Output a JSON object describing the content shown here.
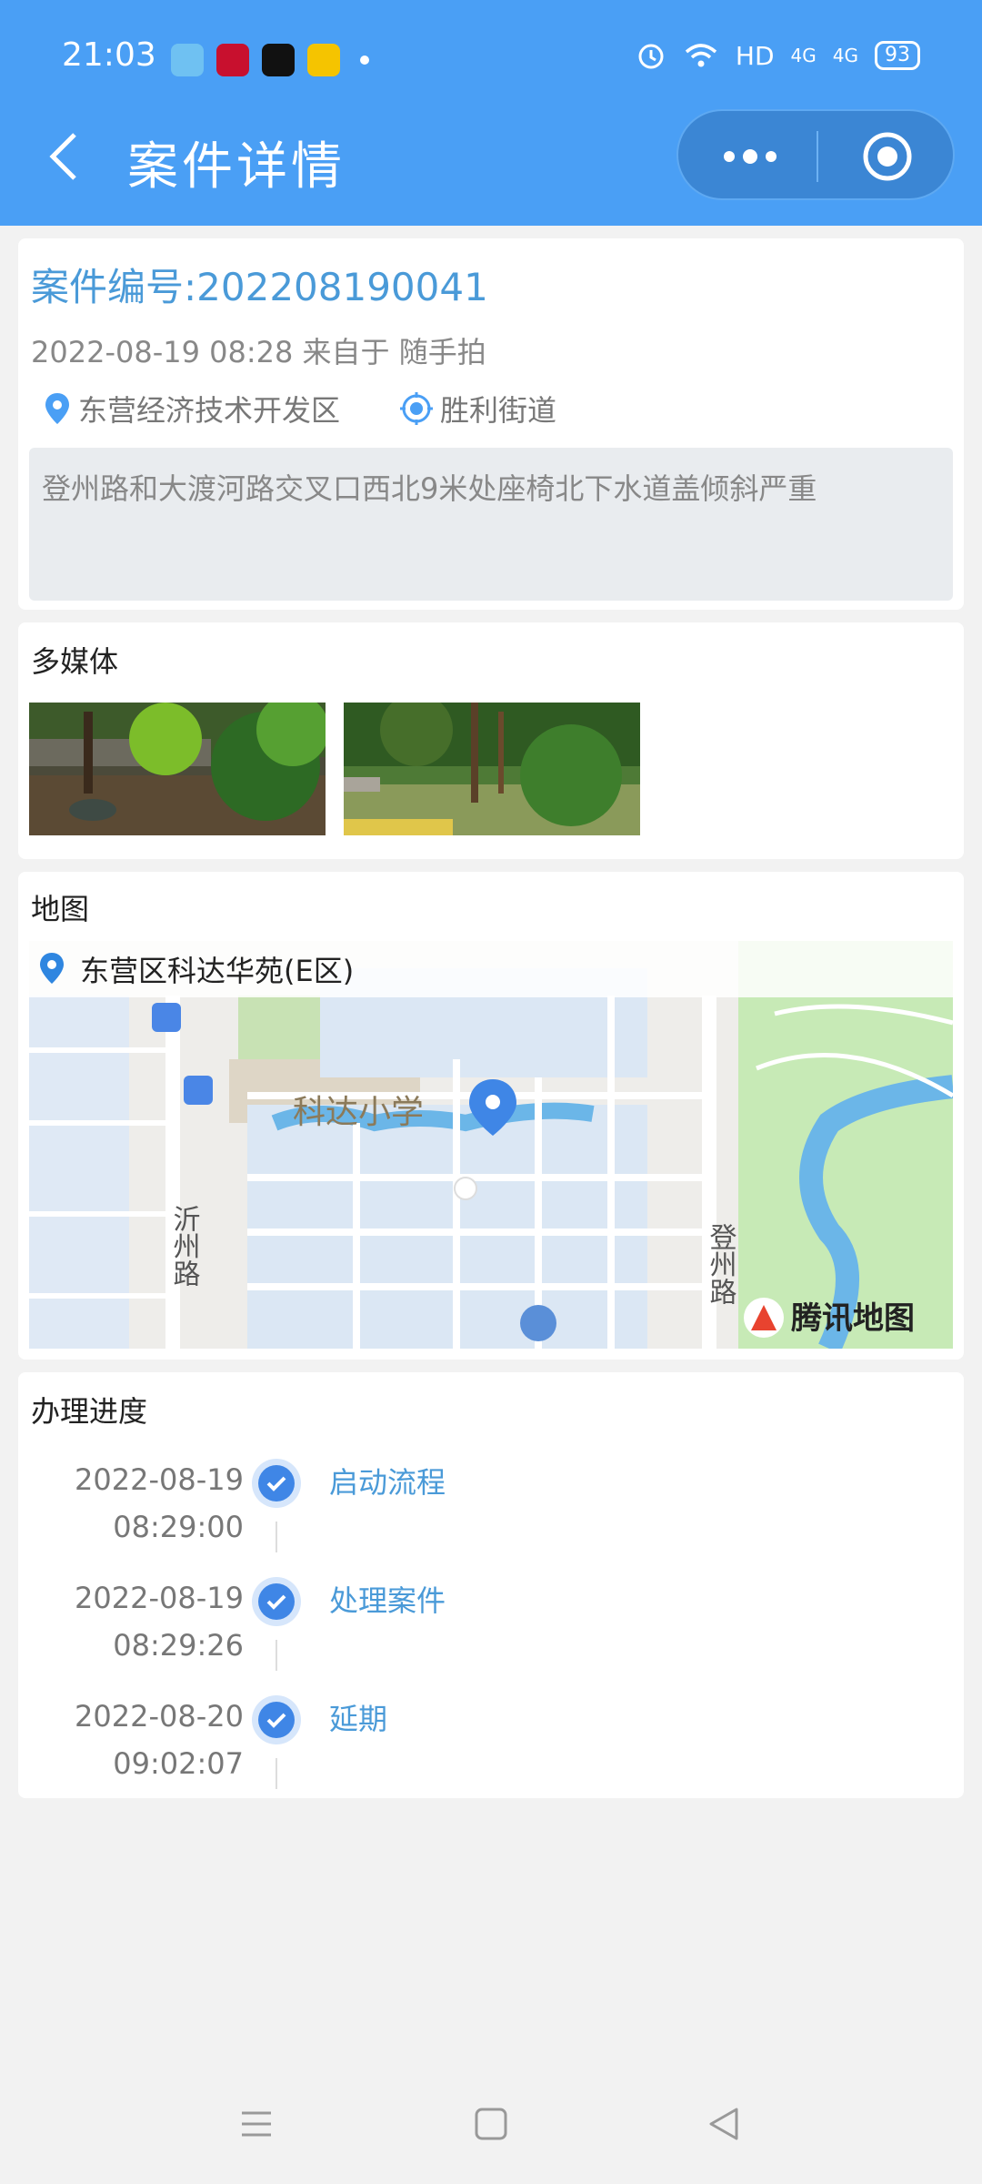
{
  "status_bar": {
    "time": "21:03",
    "network": "HD",
    "signal1": "4G",
    "signal2": "4G",
    "battery": "93"
  },
  "header": {
    "title": "案件详情"
  },
  "case": {
    "number": "案件编号:202208190041",
    "meta": "2022-08-19 08:28 来自于 随手拍",
    "district": "东营经济技术开发区",
    "street": "胜利街道",
    "description": "登州路和大渡河路交叉口西北9米处座椅北下水道盖倾斜严重"
  },
  "media": {
    "title": "多媒体"
  },
  "map": {
    "title": "地图",
    "address": "东营区科达华苑(E区)",
    "labels": {
      "school": "科达小学",
      "road_left": "沂州路",
      "road_right": "登州路",
      "brand": "腾讯地图"
    }
  },
  "progress": {
    "title": "办理进度",
    "steps": [
      {
        "date": "2022-08-19",
        "time": "08:29:00",
        "label": "启动流程"
      },
      {
        "date": "2022-08-19",
        "time": "08:29:26",
        "label": "处理案件"
      },
      {
        "date": "2022-08-20",
        "time": "09:02:07",
        "label": "延期"
      }
    ]
  },
  "colors": {
    "primary": "#4a9ff5",
    "link": "#4a9ad8",
    "check": "#3f86e6"
  }
}
